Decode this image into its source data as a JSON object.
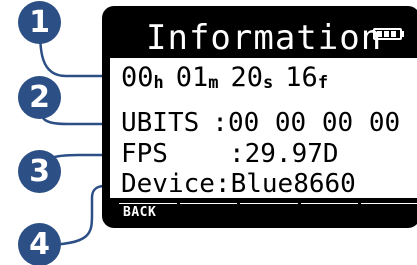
{
  "screen": {
    "title": "Information",
    "battery_icon": "battery-full-icon",
    "timecode": {
      "hours": "00",
      "hours_unit": "h",
      "minutes": "01",
      "minutes_unit": "m",
      "seconds": "20",
      "seconds_unit": "s",
      "frames": "16",
      "frames_unit": "f"
    },
    "ubits": {
      "label": "UBITS",
      "separator": ":",
      "value": "00 00 00 00"
    },
    "fps": {
      "label": "FPS",
      "separator": ":",
      "value": "29.97D"
    },
    "device": {
      "label": "Device",
      "separator": ":",
      "value": "Blue8660"
    },
    "softkeys": [
      "BACK",
      "",
      "",
      "",
      ""
    ]
  },
  "callouts": [
    "1",
    "2",
    "3",
    "4"
  ],
  "colors": {
    "callout": "#2c4f86",
    "leader": "#2c4f86",
    "display_bg": "#ffffff",
    "display_fg": "#000000"
  }
}
